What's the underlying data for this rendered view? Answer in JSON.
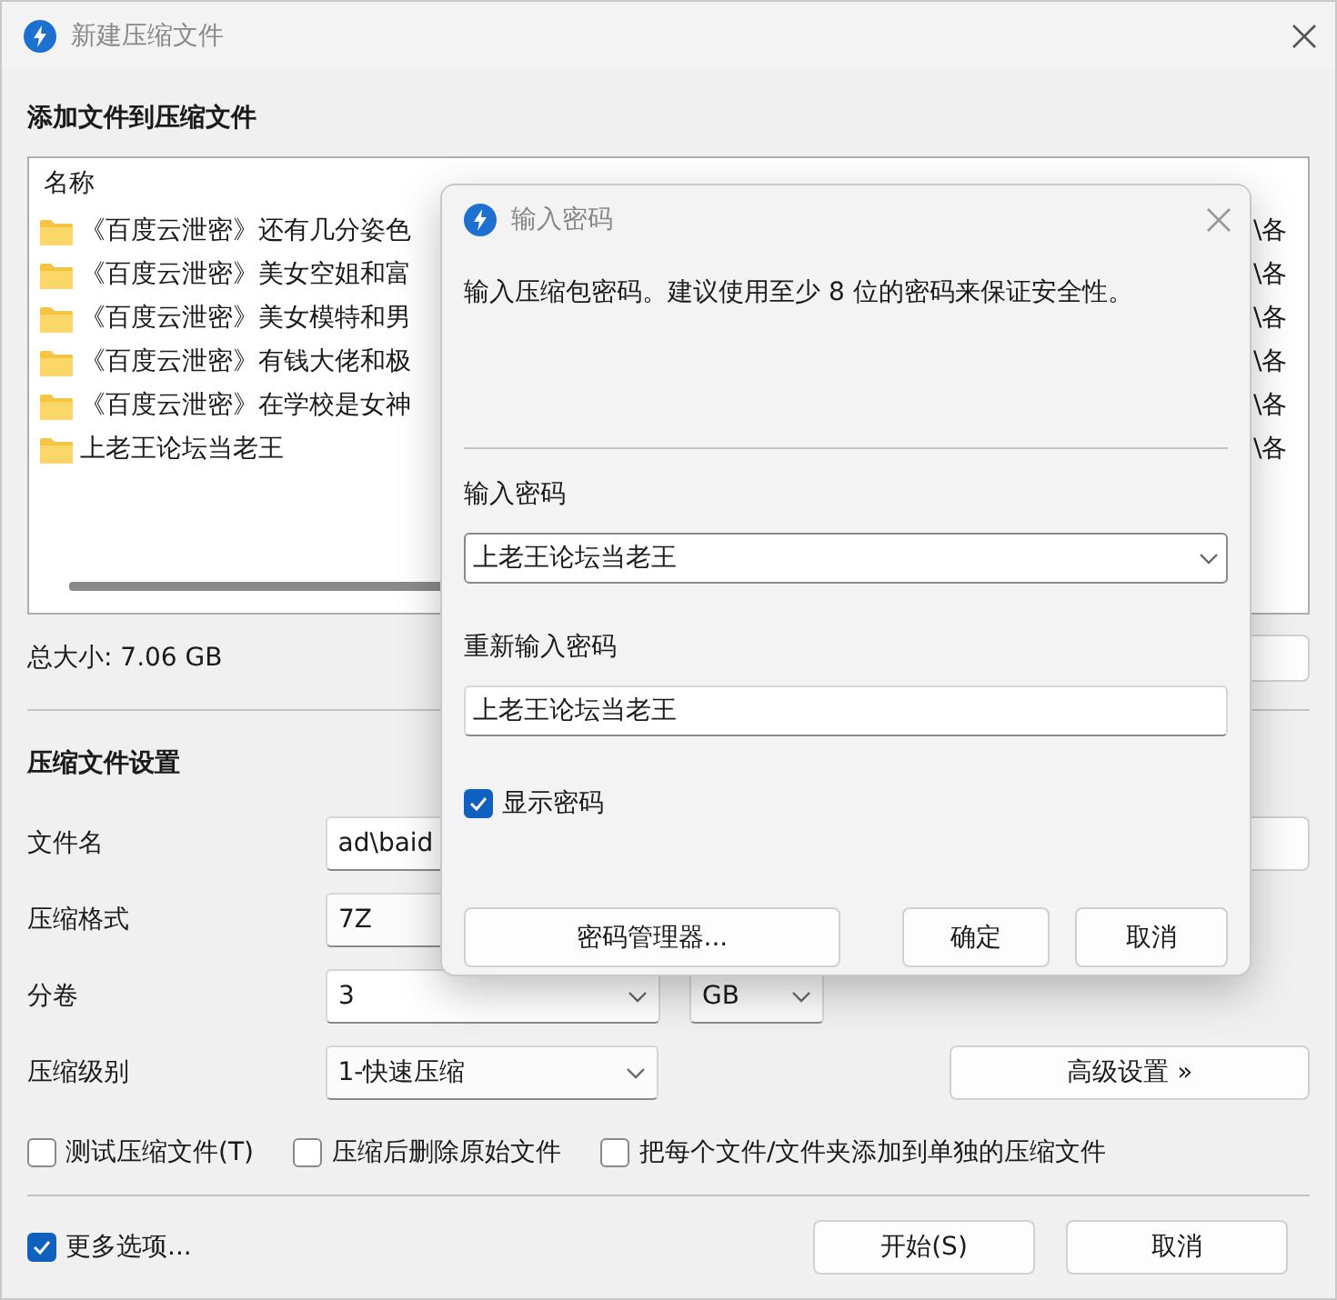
{
  "window": {
    "title": "新建压缩文件"
  },
  "files": {
    "heading": "添加文件到压缩文件",
    "column_1": "名称",
    "rows": [
      {
        "kind": "folder",
        "name": "《百度云泄密》还有几分姿色",
        "column_3": "\\各"
      },
      {
        "kind": "folder",
        "name": "《百度云泄密》美女空姐和富",
        "column_3": "\\各"
      },
      {
        "kind": "folder",
        "name": "《百度云泄密》美女模特和男",
        "column_3": "\\各"
      },
      {
        "kind": "folder",
        "name": "《百度云泄密》有钱大佬和极",
        "column_3": "\\各"
      },
      {
        "kind": "folder",
        "name": "《百度云泄密》在学校是女神",
        "column_3": "\\各"
      },
      {
        "kind": "folder",
        "name": "上老王论坛当老王",
        "column_3": "\\各"
      }
    ]
  },
  "total_size": "总大小: 7.06 GB",
  "settings": {
    "heading": "压缩文件设置",
    "file_name": {
      "label": "文件名",
      "value": "ad\\baid"
    },
    "format": {
      "label": "压缩格式",
      "value": "7Z"
    },
    "volume": {
      "label": "分卷",
      "value": "3",
      "unit": "GB"
    },
    "level": {
      "label": "压缩级别",
      "value": "1-快速压缩"
    },
    "advanced_button": "高级设置 »"
  },
  "options": [
    {
      "label": "测试压缩文件(T)",
      "checked": false
    },
    {
      "label": "压缩后删除原始文件",
      "checked": false
    },
    {
      "label": "把每个文件/文件夹添加到单独的压缩文件",
      "checked": false
    }
  ],
  "more_options": {
    "label": "更多选项...",
    "checked": true
  },
  "buttons": [
    "开始(S)",
    "取消"
  ],
  "password_dialog": {
    "title": "输入密码",
    "description": "输入压缩包密码。建议使用至少 8 位的密码来保证安全性。",
    "password_label": "输入密码",
    "password_value": "上老王论坛当老王",
    "repeat_label": "重新输入密码",
    "repeat_value": "上老王论坛当老王",
    "show_password": {
      "label": "显示密码",
      "checked": true
    },
    "manager_button": "密码管理器...",
    "buttons": [
      "确定",
      "取消"
    ]
  }
}
